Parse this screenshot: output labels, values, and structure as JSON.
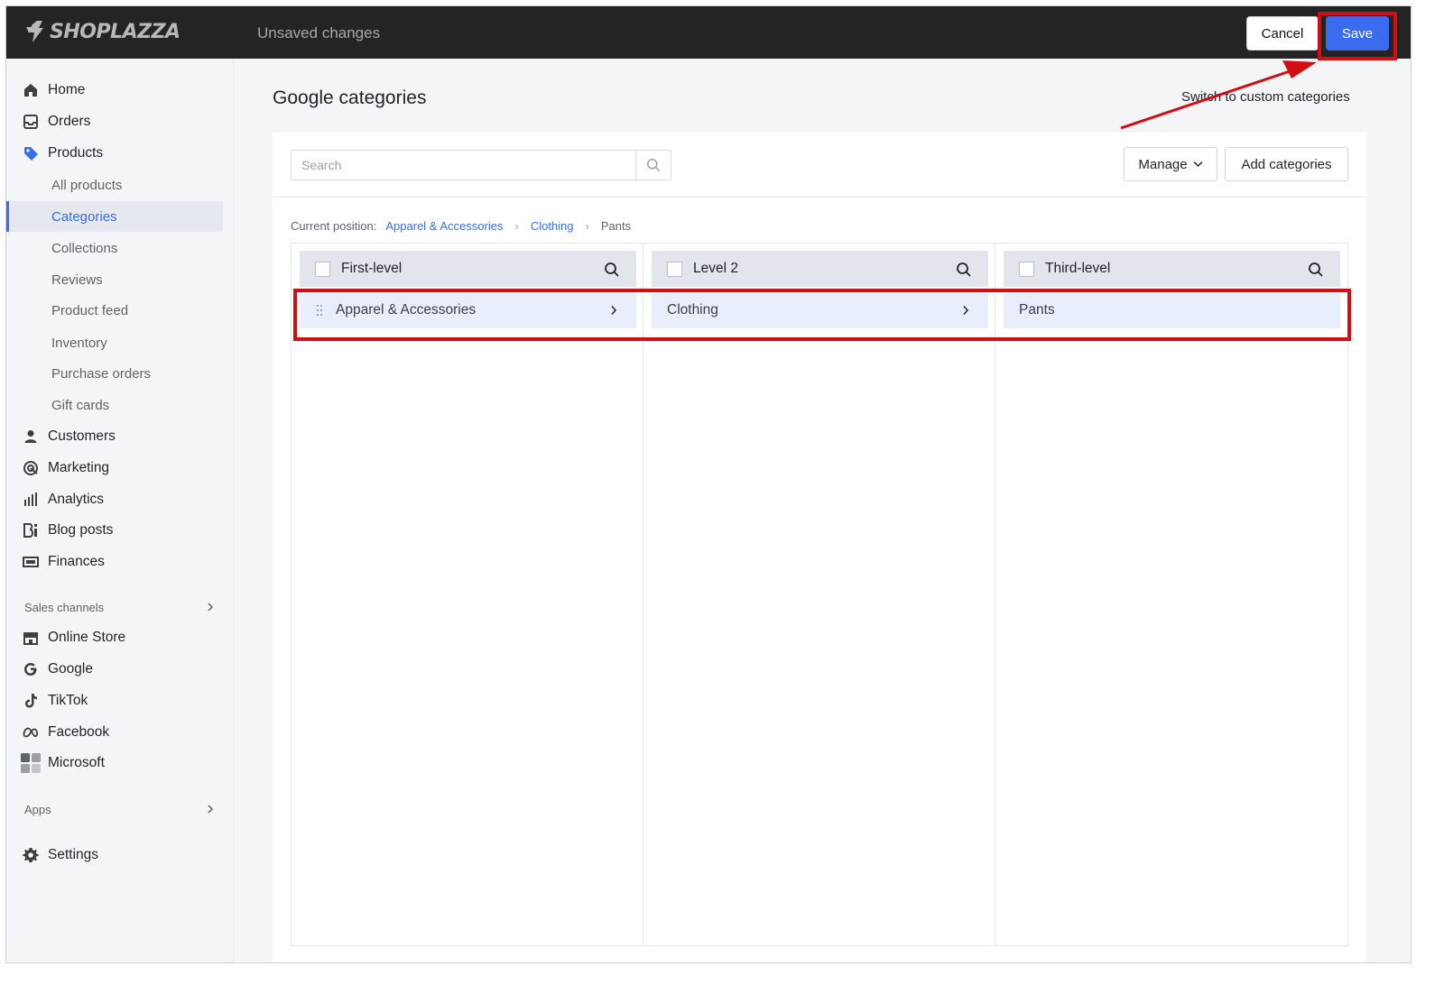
{
  "app": {
    "brand": "SHOPLAZZA",
    "status": "Unsaved changes"
  },
  "topbar": {
    "cancel_label": "Cancel",
    "save_label": "Save"
  },
  "sidebar": {
    "home": "Home",
    "orders": "Orders",
    "products": "Products",
    "products_sub": [
      "All products",
      "Categories",
      "Collections",
      "Reviews",
      "Product feed",
      "Inventory",
      "Purchase orders",
      "Gift cards"
    ],
    "customers": "Customers",
    "marketing": "Marketing",
    "analytics": "Analytics",
    "blog_posts": "Blog posts",
    "finances": "Finances",
    "sales_channels_label": "Sales channels",
    "channels": [
      "Online Store",
      "Google",
      "TikTok",
      "Facebook",
      "Microsoft"
    ],
    "apps_label": "Apps",
    "settings": "Settings"
  },
  "page": {
    "title": "Google categories",
    "switch_link": "Switch to custom categories"
  },
  "toolbar": {
    "search_placeholder": "Search",
    "manage_label": "Manage",
    "add_label": "Add categories"
  },
  "breadcrumb": {
    "label": "Current position:",
    "items": [
      "Apparel & Accessories",
      "Clothing",
      "Pants"
    ]
  },
  "columns": [
    {
      "header": "First-level",
      "row": "Apparel & Accessories"
    },
    {
      "header": "Level 2",
      "row": "Clothing"
    },
    {
      "header": "Third-level",
      "row": "Pants"
    }
  ],
  "colors": {
    "accent": "#3b6cf0",
    "topbar": "#242424",
    "annotation": "#d40d12"
  }
}
